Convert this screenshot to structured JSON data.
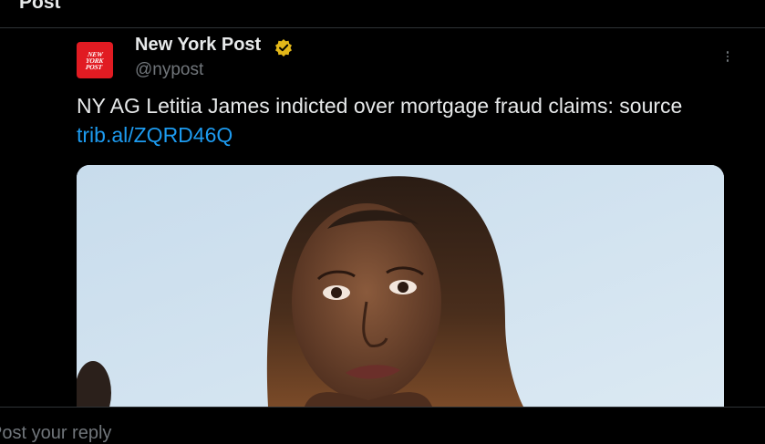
{
  "header": {
    "title": "Post"
  },
  "tweet": {
    "avatar_text_lines": [
      "NEW",
      "YORK",
      "POST"
    ],
    "display_name": "New York Post",
    "handle": "@nypost",
    "text_main": "NY AG Letitia James indicted over mortgage fraud claims: source ",
    "link_text": "trib.al/ZQRD46Q",
    "verified_color": "#e2b719",
    "link_color": "#1d9bf0"
  },
  "reply": {
    "placeholder": "Post your reply"
  },
  "icons": {
    "verified": "verified-badge-icon",
    "more": "more-options-icon"
  }
}
